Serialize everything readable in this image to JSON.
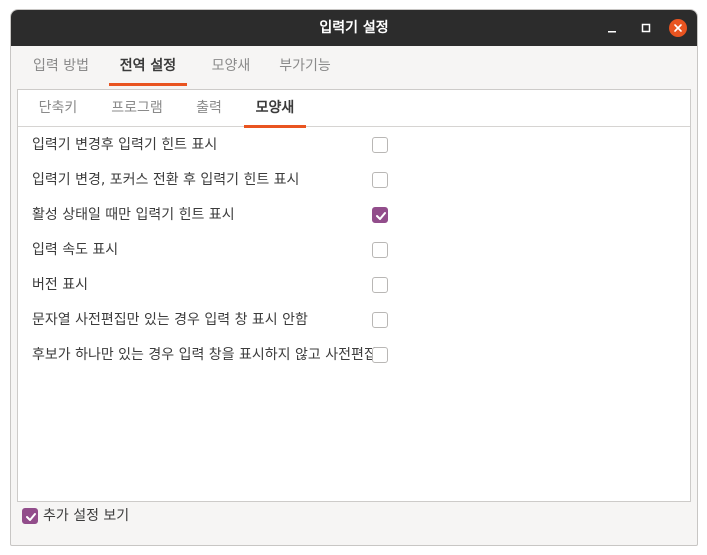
{
  "window": {
    "title": "입력기 설정",
    "controls": {
      "minimize_icon": "minimize-icon",
      "maximize_icon": "maximize-icon",
      "close_icon": "close-icon",
      "close_color": "#e95420"
    }
  },
  "main_tabs": [
    {
      "label": "입력 방법",
      "active": false
    },
    {
      "label": "전역 설정",
      "active": true
    },
    {
      "label": "모양새",
      "active": false
    },
    {
      "label": "부가기능",
      "active": false
    }
  ],
  "sub_tabs": [
    {
      "label": "단축키",
      "active": false
    },
    {
      "label": "프로그램",
      "active": false
    },
    {
      "label": "출력",
      "active": false
    },
    {
      "label": "모양새",
      "active": true
    }
  ],
  "options": [
    {
      "label": "입력기 변경후 입력기 힌트 표시",
      "checked": false
    },
    {
      "label": "입력기 변경, 포커스 전환 후 입력기 힌트 표시",
      "checked": false
    },
    {
      "label": "활성 상태일 때만 입력기 힌트 표시",
      "checked": true
    },
    {
      "label": "입력 속도 표시",
      "checked": false
    },
    {
      "label": "버전 표시",
      "checked": false
    },
    {
      "label": "문자열 사전편집만 있는 경우 입력 창 표시 안함",
      "checked": false
    },
    {
      "label": "후보가 하나만 있는 경우 입력 창을 표시하지 않고 사전편집",
      "checked": false
    }
  ],
  "footer": {
    "show_advanced_label": "추가 설정 보기",
    "show_advanced_checked": true
  },
  "colors": {
    "accent": "#e95420",
    "check": "#924d8b",
    "titlebar": "#2c2c2c"
  }
}
